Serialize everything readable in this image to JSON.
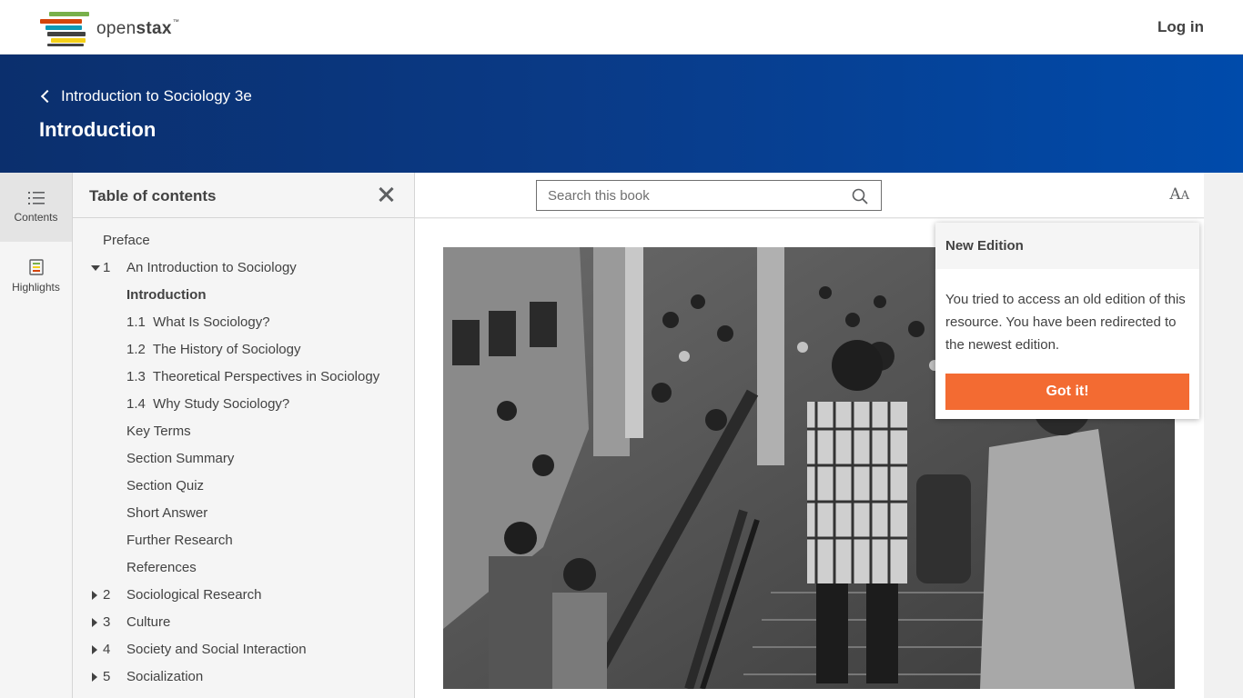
{
  "brand": {
    "name_prefix": "open",
    "name_suffix": "stax",
    "tm": "™"
  },
  "nav": {
    "login_label": "Log in"
  },
  "book_header": {
    "back_label": "Introduction to Sociology 3e",
    "page_title": "Introduction"
  },
  "rail": {
    "contents_label": "Contents",
    "highlights_label": "Highlights"
  },
  "toc": {
    "title": "Table of contents",
    "items": [
      {
        "num": "",
        "label": "Preface",
        "kind": "top"
      },
      {
        "num": "1",
        "label": "An Introduction to Sociology",
        "kind": "chapter-open"
      },
      {
        "num": "",
        "label": "Introduction",
        "kind": "sub-active"
      },
      {
        "num": "",
        "label": "1.1  What Is Sociology?",
        "kind": "sub"
      },
      {
        "num": "",
        "label": "1.2  The History of Sociology",
        "kind": "sub"
      },
      {
        "num": "",
        "label": "1.3  Theoretical Perspectives in Sociology",
        "kind": "sub"
      },
      {
        "num": "",
        "label": "1.4  Why Study Sociology?",
        "kind": "sub"
      },
      {
        "num": "",
        "label": "Key Terms",
        "kind": "sub"
      },
      {
        "num": "",
        "label": "Section Summary",
        "kind": "sub"
      },
      {
        "num": "",
        "label": "Section Quiz",
        "kind": "sub"
      },
      {
        "num": "",
        "label": "Short Answer",
        "kind": "sub"
      },
      {
        "num": "",
        "label": "Further Research",
        "kind": "sub"
      },
      {
        "num": "",
        "label": "References",
        "kind": "sub"
      },
      {
        "num": "2",
        "label": "Sociological Research",
        "kind": "chapter"
      },
      {
        "num": "3",
        "label": "Culture",
        "kind": "chapter"
      },
      {
        "num": "4",
        "label": "Society and Social Interaction",
        "kind": "chapter"
      },
      {
        "num": "5",
        "label": "Socialization",
        "kind": "chapter"
      }
    ]
  },
  "toolbar": {
    "search_placeholder": "Search this book",
    "text_size_big": "A",
    "text_size_small": "A"
  },
  "popup": {
    "title": "New Edition",
    "body": "You tried to access an old edition of this resource. You have been redirected to the newest edition.",
    "button_label": "Got it!"
  },
  "colors": {
    "header_blue_start": "#0b2f6d",
    "header_blue_end": "#004bab",
    "accent_orange": "#f36b32"
  }
}
